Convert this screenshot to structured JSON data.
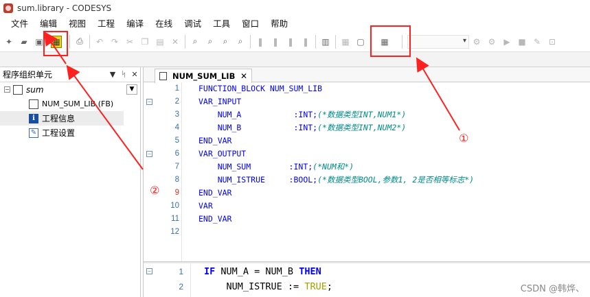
{
  "window": {
    "title": "sum.library - CODESYS"
  },
  "menu": [
    "文件",
    "编辑",
    "视图",
    "工程",
    "编译",
    "在线",
    "调试",
    "工具",
    "窗口",
    "帮助"
  ],
  "left_panel": {
    "title": "程序组织单元",
    "tree": {
      "root": "sum",
      "items": [
        "NUM_SUM_LIB (FB)",
        "工程信息",
        "工程设置"
      ]
    }
  },
  "editor": {
    "tab_label": "NUM_SUM_LIB",
    "declaration_lines": [
      {
        "n": "1",
        "kw": "FUNCTION_BLOCK NUM_SUM_LIB",
        "code": "",
        "comment": ""
      },
      {
        "n": "2",
        "kw": "VAR_INPUT",
        "code": "",
        "comment": ""
      },
      {
        "n": "3",
        "kw": "",
        "code": "    NUM_A           :INT;",
        "comment": "(*数据类型INT,NUM1*)"
      },
      {
        "n": "4",
        "kw": "",
        "code": "    NUM_B           :INT;",
        "comment": "(*数据类型INT,NUM2*)"
      },
      {
        "n": "5",
        "kw": "END_VAR",
        "code": "",
        "comment": ""
      },
      {
        "n": "6",
        "kw": "VAR_OUTPUT",
        "code": "",
        "comment": ""
      },
      {
        "n": "7",
        "kw": "",
        "code": "    NUM_SUM        :INT;",
        "comment": "(*NUM和*)"
      },
      {
        "n": "8",
        "kw": "",
        "code": "    NUM_ISTRUE     :BOOL;",
        "comment": "(*数据类型BOOL,参数1, 2是否相等标志*)"
      },
      {
        "n": "9",
        "kw": "END_VAR",
        "code": "",
        "comment": ""
      },
      {
        "n": "10",
        "kw": "VAR",
        "code": "",
        "comment": ""
      },
      {
        "n": "11",
        "kw": "END_VAR",
        "code": "",
        "comment": ""
      },
      {
        "n": "12",
        "kw": "",
        "code": "",
        "comment": ""
      }
    ],
    "implementation_lines": [
      {
        "n": "1",
        "kw1": "IF",
        "mid": " NUM_A = NUM_B ",
        "kw2": "THEN",
        "tail": "",
        "val": ""
      },
      {
        "n": "2",
        "kw1": "",
        "mid": "    NUM_ISTRUE := ",
        "kw2": "",
        "tail": ";",
        "val": "TRUE"
      }
    ]
  },
  "annotations": {
    "marker_1": "①",
    "marker_2": "②",
    "color": "#ff2020"
  },
  "watermark": "CSDN @韩烨、"
}
